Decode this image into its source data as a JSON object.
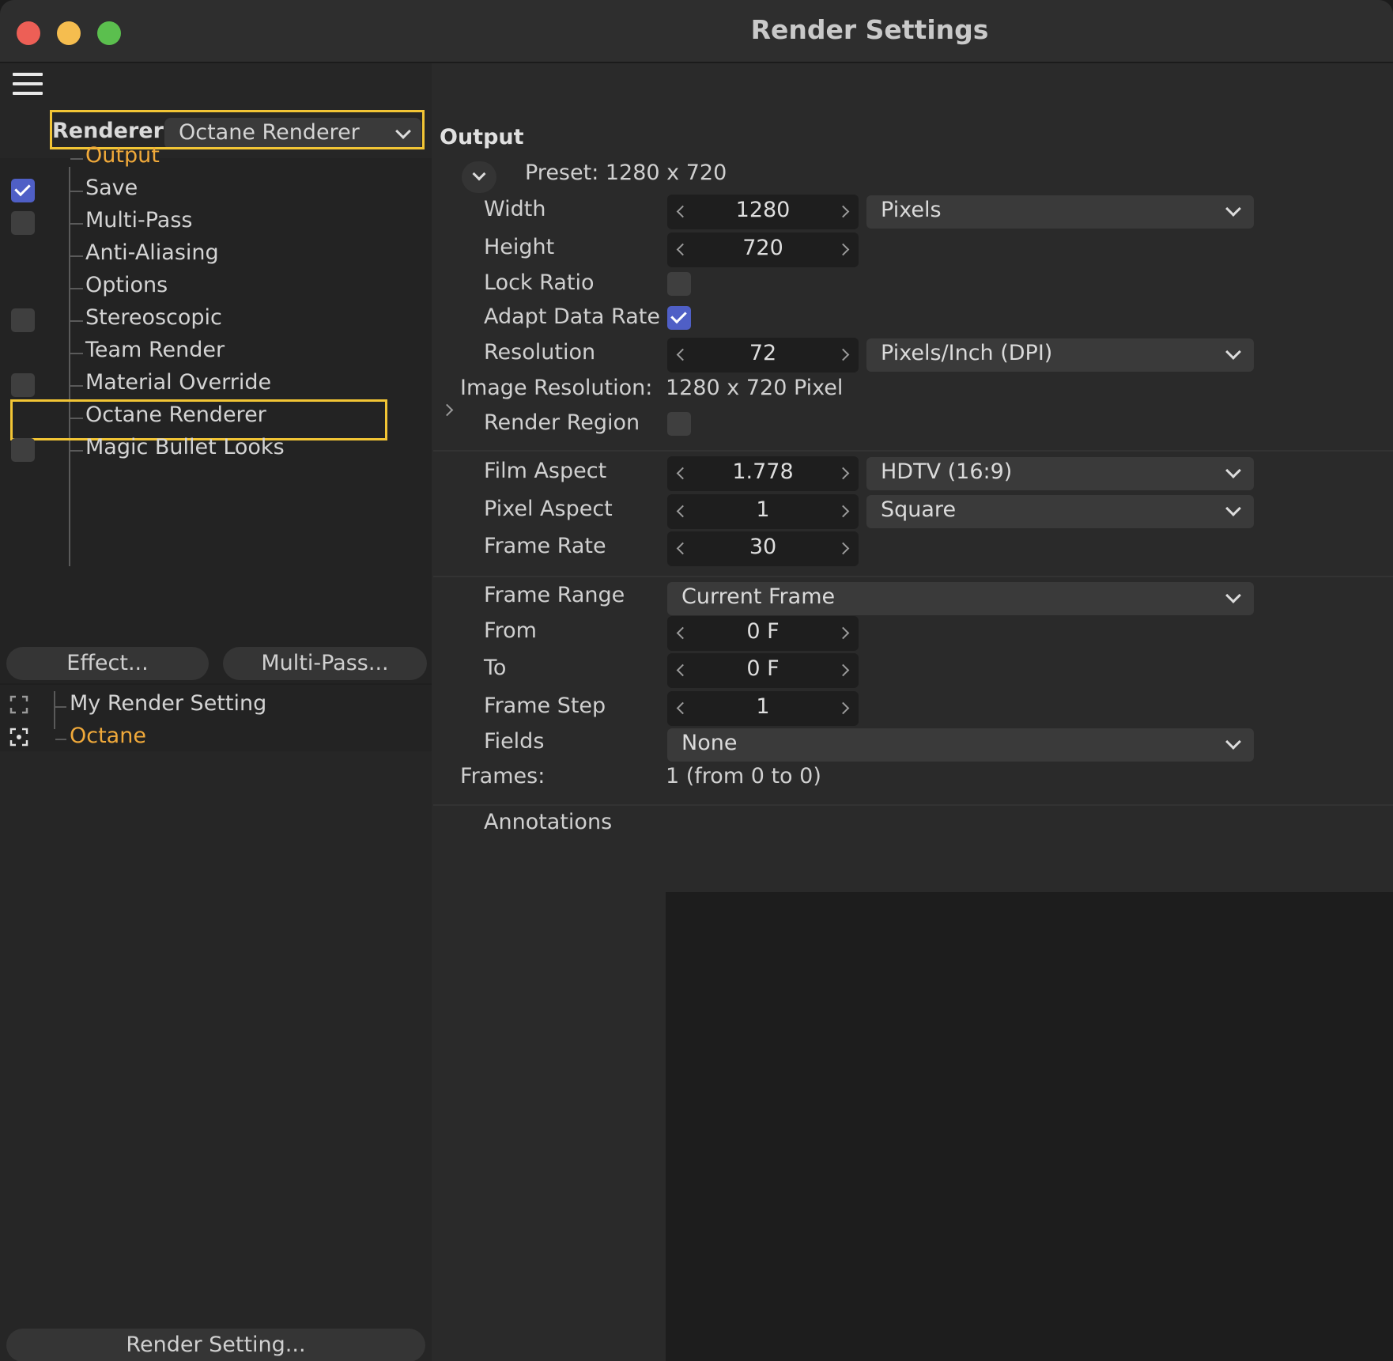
{
  "window": {
    "title": "Render Settings",
    "traffic_lights": {
      "close": "#ed5f56",
      "minimize": "#f5bd4f",
      "zoom": "#5bbf4e"
    }
  },
  "left_panel": {
    "renderer_label": "Renderer",
    "renderer_value": "Octane Renderer",
    "highlight_color": "#f2c535",
    "tree": [
      {
        "label": "Output",
        "checkbox": null,
        "active": true
      },
      {
        "label": "Save",
        "checkbox": true,
        "active": false
      },
      {
        "label": "Multi-Pass",
        "checkbox": false,
        "active": false
      },
      {
        "label": "Anti-Aliasing",
        "checkbox": null,
        "active": false
      },
      {
        "label": "Options",
        "checkbox": null,
        "active": false
      },
      {
        "label": "Stereoscopic",
        "checkbox": false,
        "active": false
      },
      {
        "label": "Team Render",
        "checkbox": null,
        "active": false
      },
      {
        "label": "Material Override",
        "checkbox": false,
        "active": false
      },
      {
        "label": "Octane Renderer",
        "checkbox": null,
        "active": false
      },
      {
        "label": "Magic Bullet Looks",
        "checkbox": false,
        "active": false
      }
    ],
    "effect_button": "Effect...",
    "multipass_button": "Multi-Pass...",
    "render_settings": [
      {
        "label": "My Render Setting",
        "active": false
      },
      {
        "label": "Octane",
        "active": true
      }
    ],
    "render_setting_button": "Render Setting..."
  },
  "right_panel": {
    "section_title": "Output",
    "preset": "Preset: 1280 x 720",
    "width": {
      "label": "Width",
      "value": "1280",
      "unit": "Pixels"
    },
    "height": {
      "label": "Height",
      "value": "720"
    },
    "lock_ratio": {
      "label": "Lock Ratio",
      "checked": false
    },
    "adapt_data_rate": {
      "label": "Adapt Data Rate",
      "checked": true
    },
    "resolution": {
      "label": "Resolution",
      "value": "72",
      "unit": "Pixels/Inch (DPI)"
    },
    "image_resolution": {
      "label": "Image Resolution:",
      "value": "1280 x 720 Pixel"
    },
    "render_region": {
      "label": "Render Region",
      "checked": false
    },
    "film_aspect": {
      "label": "Film Aspect",
      "value": "1.778",
      "preset": "HDTV (16:9)"
    },
    "pixel_aspect": {
      "label": "Pixel Aspect",
      "value": "1",
      "preset": "Square"
    },
    "frame_rate": {
      "label": "Frame Rate",
      "value": "30"
    },
    "frame_range": {
      "label": "Frame Range",
      "value": "Current Frame"
    },
    "from": {
      "label": "From",
      "value": "0 F"
    },
    "to": {
      "label": "To",
      "value": "0 F"
    },
    "frame_step": {
      "label": "Frame Step",
      "value": "1"
    },
    "fields": {
      "label": "Fields",
      "value": "None"
    },
    "frames": {
      "label": "Frames:",
      "value": "1 (from 0 to 0)"
    },
    "annotations": {
      "label": "Annotations"
    }
  },
  "accent": {
    "active_text": "#f0a93a",
    "checkbox_on": "#4f5fc6"
  }
}
